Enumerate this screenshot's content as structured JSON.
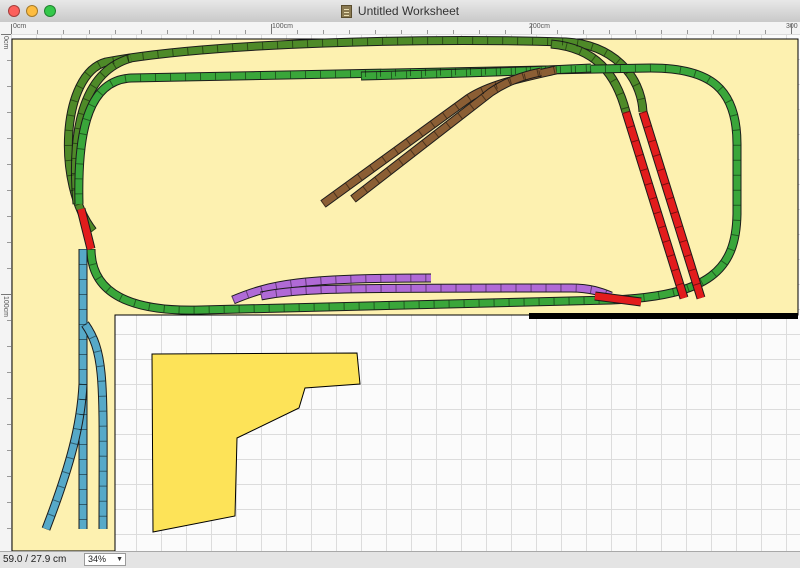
{
  "window": {
    "title": "Untitled Worksheet",
    "buttons": [
      {
        "name": "close",
        "color": "#fc605c"
      },
      {
        "name": "minimize",
        "color": "#fdbc40"
      },
      {
        "name": "zoom",
        "color": "#34c84a"
      }
    ]
  },
  "ruler": {
    "unit": "cm",
    "horizontal_labels": [
      "0cm",
      "100cm",
      "200cm",
      "300"
    ],
    "vertical_labels": [
      "0cm",
      "100cm"
    ]
  },
  "status": {
    "coords": "59.0 /  27.9 cm",
    "zoom": "34%",
    "zoom_arrow": "▼"
  },
  "colors": {
    "baseboard": "#fdf1b0",
    "green_track": "#3aa63a",
    "dark_green_track": "#4e8a28",
    "brown_track": "#8b5e34",
    "purple_track": "#b06ad6",
    "blue_track": "#56a9c8",
    "red_track": "#e21c1c",
    "shape_fill": "#fde358",
    "edge": "#000000"
  },
  "icons": {
    "document": "document-icon",
    "dropdown": "chevron-down-icon"
  }
}
